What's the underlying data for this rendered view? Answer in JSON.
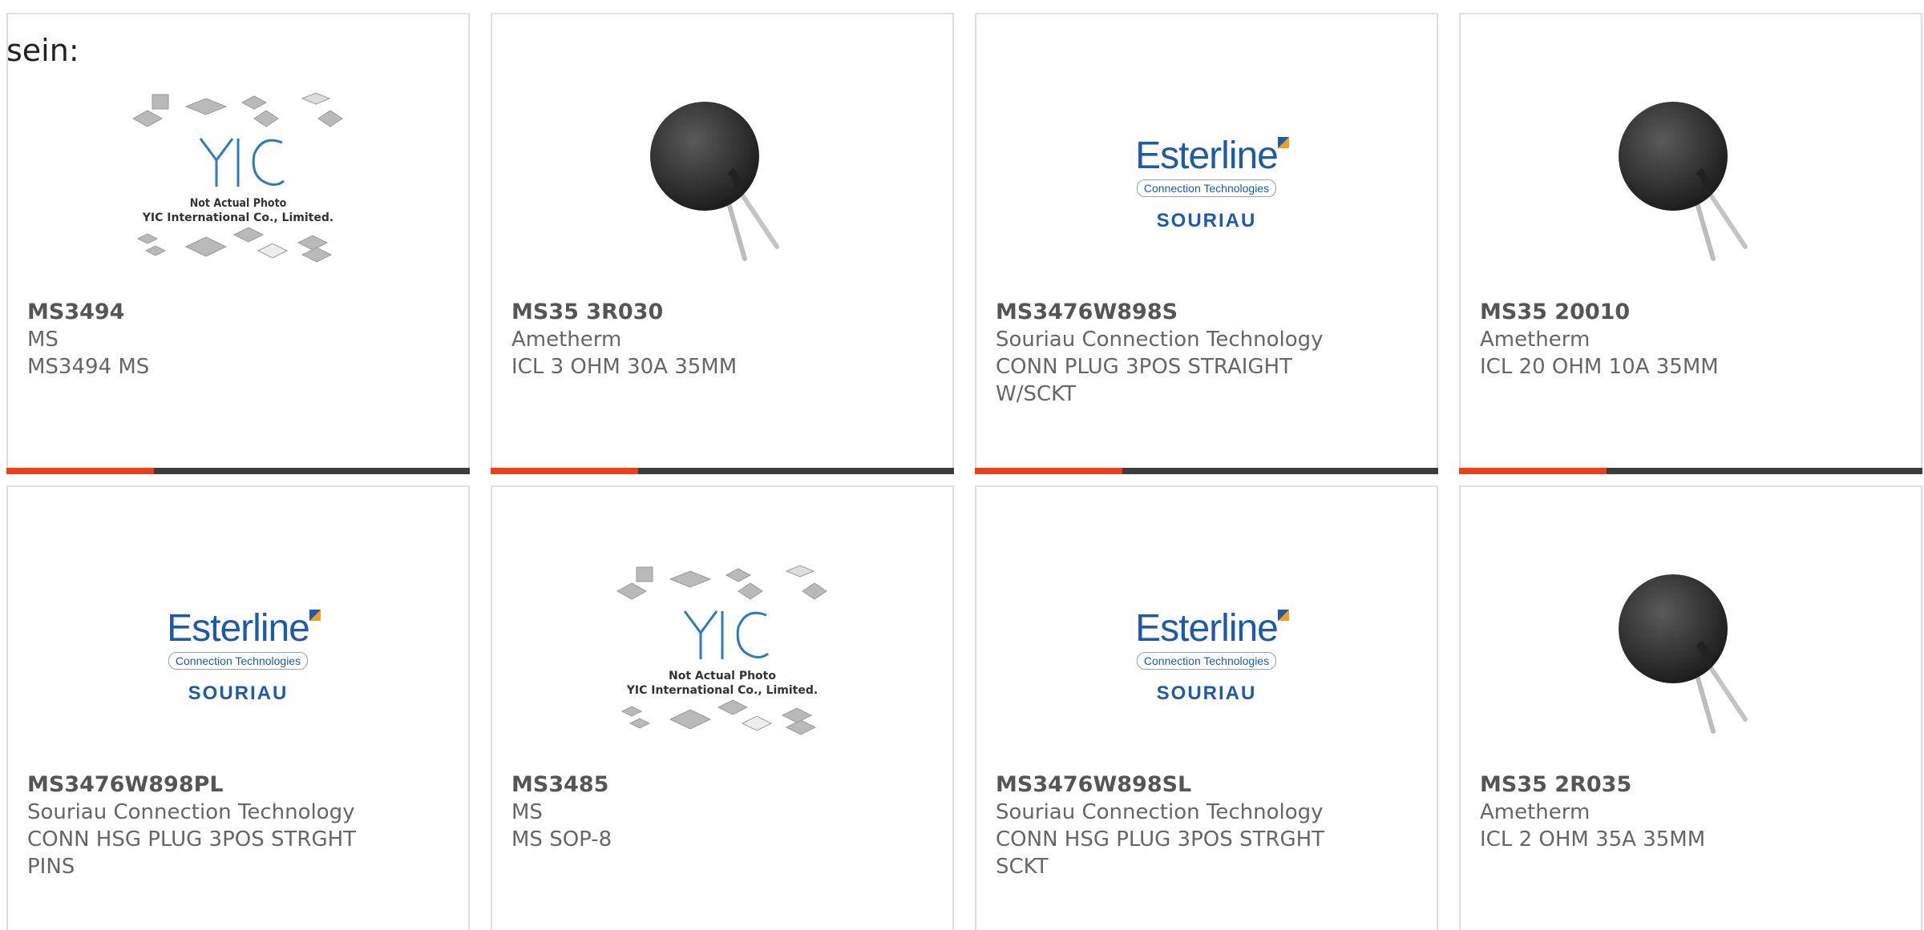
{
  "intro_text": "sein:",
  "cards": [
    {
      "part": "MS3494",
      "maker": "MS",
      "desc": "MS3494 MS",
      "image": "yic-placeholder-image",
      "not_actual": "Not Actual Photo",
      "company": "YIC International Co., Limited."
    },
    {
      "part": "MS35 3R030",
      "maker": "Ametherm",
      "desc": "ICL 3 OHM 30A 35MM",
      "image": "thermistor-image"
    },
    {
      "part": "MS3476W898S",
      "maker": "Souriau Connection Technology",
      "desc": "CONN PLUG 3POS STRAIGHT W/SCKT",
      "image": "esterline-logo",
      "logo_word": "Esterline",
      "logo_sub": "Connection Technologies",
      "logo_brand": "SOURIAU"
    },
    {
      "part": "MS35 20010",
      "maker": "Ametherm",
      "desc": "ICL 20 OHM 10A 35MM",
      "image": "thermistor-image"
    },
    {
      "part": "MS3476W898PL",
      "maker": "Souriau Connection Technology",
      "desc": "CONN HSG PLUG 3POS STRGHT PINS",
      "image": "esterline-logo",
      "logo_word": "Esterline",
      "logo_sub": "Connection Technologies",
      "logo_brand": "SOURIAU"
    },
    {
      "part": "MS3485",
      "maker": "MS",
      "desc": "MS SOP-8",
      "image": "yic-placeholder-image",
      "not_actual": "Not Actual Photo",
      "company": "YIC International Co., Limited."
    },
    {
      "part": "MS3476W898SL",
      "maker": "Souriau Connection Technology",
      "desc": "CONN HSG PLUG 3POS STRGHT SCKT",
      "image": "esterline-logo",
      "logo_word": "Esterline",
      "logo_sub": "Connection Technologies",
      "logo_brand": "SOURIAU"
    },
    {
      "part": "MS35 2R035",
      "maker": "Ametherm",
      "desc": "ICL 2 OHM 35A 35MM",
      "image": "thermistor-image"
    }
  ],
  "colors": {
    "accent": "#e8401c",
    "bar": "#3d3d3d",
    "logo_blue": "#1f5aa8",
    "text": "#666666"
  }
}
